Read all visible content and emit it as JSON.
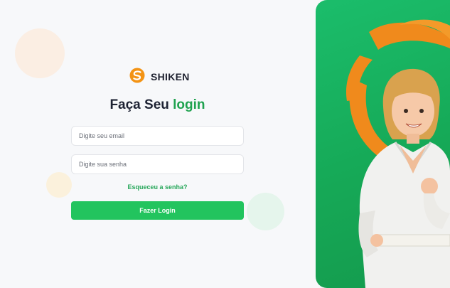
{
  "brand": {
    "name": "SHIKEN",
    "logo_icon": "shiken-swirl-logo-icon",
    "accent": "#f39314"
  },
  "login": {
    "title_prefix": "Faça Seu",
    "title_accent": "login",
    "email_placeholder": "Digite seu email",
    "password_placeholder": "Digite sua senha",
    "forgot_label": "Esqueceu a senha?",
    "submit_label": "Fazer Login"
  },
  "hero": {
    "description_icon": "karate-girl-illustration"
  },
  "colors": {
    "green": "#22c45e",
    "panel": "#16a957",
    "text": "#1d2233"
  }
}
